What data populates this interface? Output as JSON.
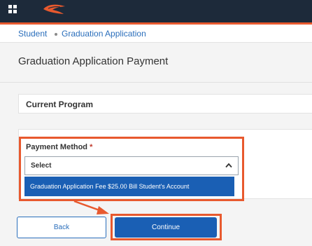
{
  "breadcrumb": {
    "items": [
      "Student",
      "Graduation Application"
    ]
  },
  "page": {
    "title": "Graduation Application Payment"
  },
  "program_section": {
    "title": "Current Program"
  },
  "payment": {
    "label": "Payment Method",
    "required_marker": "*",
    "select_value": "Select",
    "options": [
      "Graduation Application Fee $25.00 Bill Student's Account"
    ]
  },
  "buttons": {
    "back": "Back",
    "continue": "Continue"
  },
  "colors": {
    "topbar": "#1d2a3a",
    "accent": "#e8592e",
    "link": "#2a6ebb",
    "primary": "#1a5fb4"
  },
  "icons": [
    "app-grid-icon",
    "logo-icon",
    "chevron-up-icon",
    "arrow-annotation"
  ]
}
